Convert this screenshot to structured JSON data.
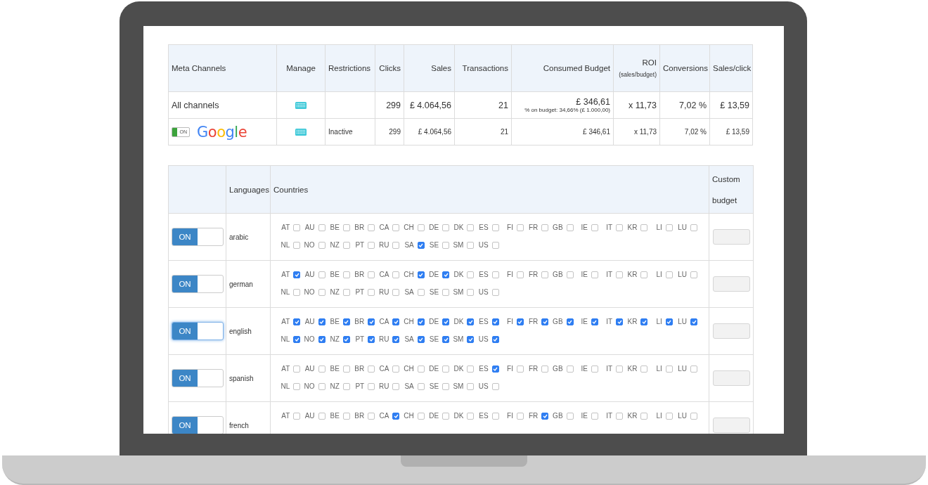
{
  "channels_table": {
    "columns": [
      {
        "label": "Meta Channels"
      },
      {
        "label": "Manage"
      },
      {
        "label": "Restrictions"
      },
      {
        "label": "Clicks"
      },
      {
        "label": "Sales"
      },
      {
        "label": "Transactions"
      },
      {
        "label": "Consumed Budget"
      },
      {
        "label": "ROI",
        "sub": "(sales/budget)"
      },
      {
        "label": "Conversions"
      },
      {
        "label": "Sales/click"
      }
    ],
    "rows": [
      {
        "kind": "total",
        "name": "All channels",
        "clicks": "299",
        "sales": "£ 4.064,56",
        "transactions": "21",
        "budget": "£ 346,61",
        "budget_note": "% on budget: 34,66% (£ 1.000,00)",
        "roi": "x 11,73",
        "conversions": "7,02 %",
        "sales_per_click": "£ 13,59"
      },
      {
        "kind": "channel",
        "toggle": {
          "label": "ON",
          "on": true
        },
        "name": "Google",
        "restrictions": "Inactive",
        "clicks": "299",
        "sales": "£ 4.064,56",
        "transactions": "21",
        "budget": "£ 346,61",
        "roi": "x 11,73",
        "conversions": "7,02 %",
        "sales_per_click": "£ 13,59"
      }
    ]
  },
  "languages_table": {
    "columns": {
      "languages": "Languages",
      "countries": "Countries",
      "budget": "Custom budget"
    },
    "rows": [
      {
        "toggle": {
          "label": "ON",
          "on": true,
          "focused": false
        },
        "language": "arabic",
        "countries": [
          {
            "code": "AT",
            "checked": false
          },
          {
            "code": "AU",
            "checked": false
          },
          {
            "code": "BE",
            "checked": false
          },
          {
            "code": "BR",
            "checked": false
          },
          {
            "code": "CA",
            "checked": false
          },
          {
            "code": "CH",
            "checked": false
          },
          {
            "code": "DE",
            "checked": false
          },
          {
            "code": "DK",
            "checked": false
          },
          {
            "code": "ES",
            "checked": false
          },
          {
            "code": "FI",
            "checked": false
          },
          {
            "code": "FR",
            "checked": false
          },
          {
            "code": "GB",
            "checked": false
          },
          {
            "code": "IE",
            "checked": false
          },
          {
            "code": "IT",
            "checked": false
          },
          {
            "code": "KR",
            "checked": false
          },
          {
            "code": "LI",
            "checked": false
          },
          {
            "code": "LU",
            "checked": false
          },
          {
            "code": "NL",
            "checked": false
          },
          {
            "code": "NO",
            "checked": false
          },
          {
            "code": "NZ",
            "checked": false
          },
          {
            "code": "PT",
            "checked": false
          },
          {
            "code": "RU",
            "checked": false
          },
          {
            "code": "SA",
            "checked": true
          },
          {
            "code": "SE",
            "checked": false
          },
          {
            "code": "SM",
            "checked": false
          },
          {
            "code": "US",
            "checked": false
          }
        ]
      },
      {
        "toggle": {
          "label": "ON",
          "on": true,
          "focused": false
        },
        "language": "german",
        "countries": [
          {
            "code": "AT",
            "checked": true
          },
          {
            "code": "AU",
            "checked": false
          },
          {
            "code": "BE",
            "checked": false
          },
          {
            "code": "BR",
            "checked": false
          },
          {
            "code": "CA",
            "checked": false
          },
          {
            "code": "CH",
            "checked": true
          },
          {
            "code": "DE",
            "checked": true
          },
          {
            "code": "DK",
            "checked": false
          },
          {
            "code": "ES",
            "checked": false
          },
          {
            "code": "FI",
            "checked": false
          },
          {
            "code": "FR",
            "checked": false
          },
          {
            "code": "GB",
            "checked": false
          },
          {
            "code": "IE",
            "checked": false
          },
          {
            "code": "IT",
            "checked": false
          },
          {
            "code": "KR",
            "checked": false
          },
          {
            "code": "LI",
            "checked": false
          },
          {
            "code": "LU",
            "checked": false
          },
          {
            "code": "NL",
            "checked": false
          },
          {
            "code": "NO",
            "checked": false
          },
          {
            "code": "NZ",
            "checked": false
          },
          {
            "code": "PT",
            "checked": false
          },
          {
            "code": "RU",
            "checked": false
          },
          {
            "code": "SA",
            "checked": false
          },
          {
            "code": "SE",
            "checked": false
          },
          {
            "code": "SM",
            "checked": false
          },
          {
            "code": "US",
            "checked": false
          }
        ]
      },
      {
        "toggle": {
          "label": "ON",
          "on": true,
          "focused": true
        },
        "language": "english",
        "countries": [
          {
            "code": "AT",
            "checked": true
          },
          {
            "code": "AU",
            "checked": true
          },
          {
            "code": "BE",
            "checked": true
          },
          {
            "code": "BR",
            "checked": true
          },
          {
            "code": "CA",
            "checked": true
          },
          {
            "code": "CH",
            "checked": true
          },
          {
            "code": "DE",
            "checked": true
          },
          {
            "code": "DK",
            "checked": true
          },
          {
            "code": "ES",
            "checked": true
          },
          {
            "code": "FI",
            "checked": true
          },
          {
            "code": "FR",
            "checked": true
          },
          {
            "code": "GB",
            "checked": true
          },
          {
            "code": "IE",
            "checked": true
          },
          {
            "code": "IT",
            "checked": true
          },
          {
            "code": "KR",
            "checked": true
          },
          {
            "code": "LI",
            "checked": true
          },
          {
            "code": "LU",
            "checked": true
          },
          {
            "code": "NL",
            "checked": true
          },
          {
            "code": "NO",
            "checked": true
          },
          {
            "code": "NZ",
            "checked": true
          },
          {
            "code": "PT",
            "checked": true
          },
          {
            "code": "RU",
            "checked": true
          },
          {
            "code": "SA",
            "checked": true
          },
          {
            "code": "SE",
            "checked": true
          },
          {
            "code": "SM",
            "checked": true
          },
          {
            "code": "US",
            "checked": true
          }
        ]
      },
      {
        "toggle": {
          "label": "ON",
          "on": true,
          "focused": false
        },
        "language": "spanish",
        "countries": [
          {
            "code": "AT",
            "checked": false
          },
          {
            "code": "AU",
            "checked": false
          },
          {
            "code": "BE",
            "checked": false
          },
          {
            "code": "BR",
            "checked": false
          },
          {
            "code": "CA",
            "checked": false
          },
          {
            "code": "CH",
            "checked": false
          },
          {
            "code": "DE",
            "checked": false
          },
          {
            "code": "DK",
            "checked": false
          },
          {
            "code": "ES",
            "checked": true
          },
          {
            "code": "FI",
            "checked": false
          },
          {
            "code": "FR",
            "checked": false
          },
          {
            "code": "GB",
            "checked": false
          },
          {
            "code": "IE",
            "checked": false
          },
          {
            "code": "IT",
            "checked": false
          },
          {
            "code": "KR",
            "checked": false
          },
          {
            "code": "LI",
            "checked": false
          },
          {
            "code": "LU",
            "checked": false
          },
          {
            "code": "NL",
            "checked": false
          },
          {
            "code": "NO",
            "checked": false
          },
          {
            "code": "NZ",
            "checked": false
          },
          {
            "code": "PT",
            "checked": false
          },
          {
            "code": "RU",
            "checked": false
          },
          {
            "code": "SA",
            "checked": false
          },
          {
            "code": "SE",
            "checked": false
          },
          {
            "code": "SM",
            "checked": false
          },
          {
            "code": "US",
            "checked": false
          }
        ]
      },
      {
        "toggle": {
          "label": "ON",
          "on": true,
          "focused": false
        },
        "language": "french",
        "countries": [
          {
            "code": "AT",
            "checked": false
          },
          {
            "code": "AU",
            "checked": false
          },
          {
            "code": "BE",
            "checked": false
          },
          {
            "code": "BR",
            "checked": false
          },
          {
            "code": "CA",
            "checked": true
          },
          {
            "code": "CH",
            "checked": false
          },
          {
            "code": "DE",
            "checked": false
          },
          {
            "code": "DK",
            "checked": false
          },
          {
            "code": "ES",
            "checked": false
          },
          {
            "code": "FI",
            "checked": false
          },
          {
            "code": "FR",
            "checked": true
          },
          {
            "code": "GB",
            "checked": false
          },
          {
            "code": "IE",
            "checked": false
          },
          {
            "code": "IT",
            "checked": false
          },
          {
            "code": "KR",
            "checked": false
          },
          {
            "code": "LI",
            "checked": false
          },
          {
            "code": "LU",
            "checked": false
          }
        ]
      }
    ]
  }
}
